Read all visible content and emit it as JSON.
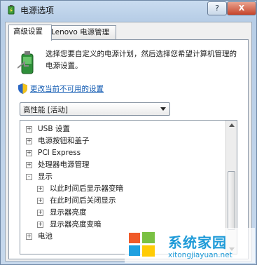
{
  "window": {
    "title": "电源选项",
    "help_label": "?",
    "close_label": "X"
  },
  "tabs": [
    {
      "label": "高级设置",
      "active": true
    },
    {
      "label": "Lenovo 电源管理",
      "active": false
    }
  ],
  "description": "选择您要自定义的电源计划，然后选择您希望计算机管理的电源设置。",
  "change_link": "更改当前不可用的设置",
  "plan_select": {
    "value": "高性能 [活动]"
  },
  "tree": [
    {
      "label": "USB 设置",
      "expander": "+",
      "level": 0
    },
    {
      "label": "电源按钮和盖子",
      "expander": "+",
      "level": 0
    },
    {
      "label": "PCI Express",
      "expander": "+",
      "level": 0
    },
    {
      "label": "处理器电源管理",
      "expander": "+",
      "level": 0
    },
    {
      "label": "显示",
      "expander": "-",
      "level": 0
    },
    {
      "label": "以此时间后显示器变暗",
      "expander": "+",
      "level": 1
    },
    {
      "label": "在此时间后关闭显示",
      "expander": "+",
      "level": 1
    },
    {
      "label": "显示器亮度",
      "expander": "+",
      "level": 1
    },
    {
      "label": "显示器亮度变暗",
      "expander": "+",
      "level": 1
    },
    {
      "label": "电池",
      "expander": "+",
      "level": 0
    }
  ],
  "watermark": {
    "name": "系统家园",
    "url": "xitongjiayuan.net"
  },
  "icons": {
    "app": "battery-power-icon",
    "shield": "uac-shield-icon",
    "logo": "windows-logo-icon"
  }
}
